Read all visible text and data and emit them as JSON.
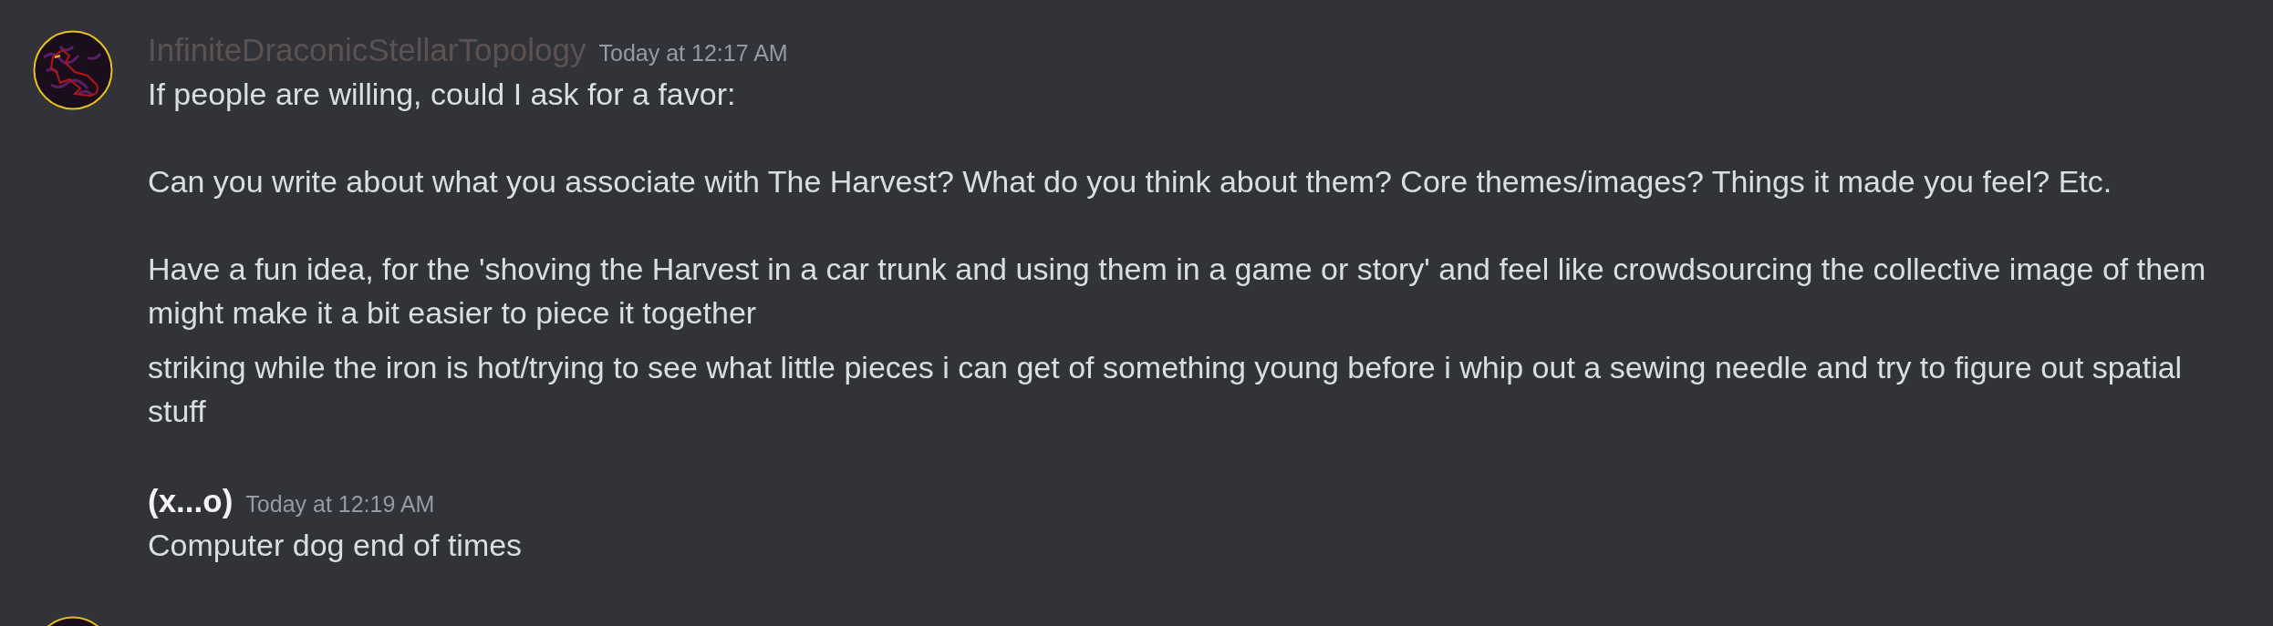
{
  "messages": [
    {
      "has_avatar": true,
      "author": "InfiniteDraconicStellarTopology",
      "color": "#5d5252",
      "timestamp": "Today at 12:17 AM",
      "blocks": [
        [
          "If people are willing, could I ask for a favor:",
          "Can you write about what you associate with The Harvest? What do you think about them? Core themes/images? Things it made you feel? Etc.",
          "Have a fun idea, for the 'shoving the Harvest in a car trunk and using them in a game or story' and feel like crowdsourcing the collective image of them might make it a bit easier to piece it together"
        ],
        [
          "striking while the iron is hot/trying to see what little pieces i can get of something young before i whip out a sewing needle and try to figure out spatial stuff"
        ]
      ]
    },
    {
      "has_avatar": false,
      "author": "(x...o)",
      "color": "#f2f3f5",
      "timestamp": "Today at 12:19 AM",
      "blocks": [
        [
          "Computer dog end of times"
        ]
      ]
    },
    {
      "has_avatar": true
    }
  ]
}
